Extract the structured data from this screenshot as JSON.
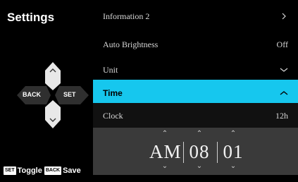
{
  "sidebar": {
    "title": "Settings",
    "dpad": {
      "left_label": "BACK",
      "right_label": "SET"
    },
    "footer": {
      "chip1": "SET",
      "text1": "Toggle",
      "chip2": "BACK",
      "text2": "Save"
    }
  },
  "menu": {
    "items": [
      {
        "label": "Information 2",
        "value": "",
        "indicator": "chevron-right-icon"
      },
      {
        "label": "Auto Brightness",
        "value": "Off"
      },
      {
        "label": "Unit",
        "value": "",
        "indicator": "chevron-down-icon"
      },
      {
        "label": "Time",
        "value": "",
        "indicator": "chevron-up-icon",
        "active": true
      },
      {
        "label": "Clock",
        "value": "12h"
      }
    ]
  },
  "time_picker": {
    "period": "AM",
    "hour": "08",
    "minute": "01"
  },
  "colors": {
    "accent": "#16c7ee",
    "picker_bg": "#3a3a3a",
    "background": "#000000"
  }
}
